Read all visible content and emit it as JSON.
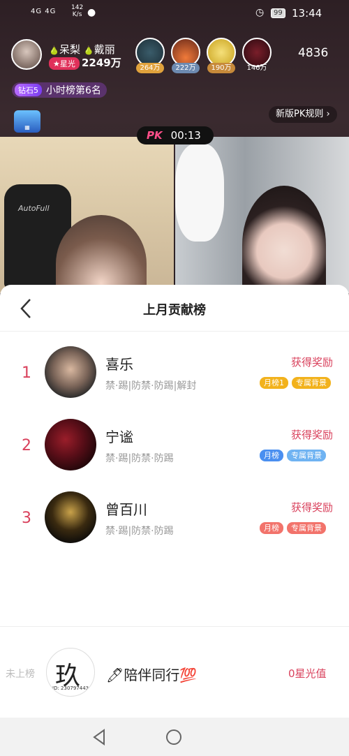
{
  "status_bar": {
    "signal": "4G 4G",
    "net_speed": "142",
    "net_unit": "K/s",
    "battery": "99",
    "time": "13:44"
  },
  "host": {
    "name1": "呆梨",
    "name2": "戴丽",
    "star_label": "★星光",
    "score": "2249万"
  },
  "viewers": [
    {
      "badge": "264万"
    },
    {
      "badge": "222万"
    },
    {
      "badge": "190万"
    },
    {
      "badge": "146万"
    }
  ],
  "viewer_count": "4836",
  "diamond": {
    "tag": "钻石5",
    "rank_text": "小时榜第6名"
  },
  "pk": {
    "rules_label": "新版PK规则 ›",
    "logo": "PK",
    "timer": "00:13"
  },
  "left_pane": {
    "chair_text": "AutoFull"
  },
  "sheet": {
    "title": "上月贡献榜",
    "rows": [
      {
        "rank": "1",
        "name": "喜乐",
        "perms": "禁·踢|防禁·防踢|解封",
        "reward": "获得奖励",
        "badge1": "月榜1",
        "badge2": "专属背景"
      },
      {
        "rank": "2",
        "name": "宁谧",
        "perms": "禁·踢|防禁·防踢",
        "reward": "获得奖励",
        "badge1": "月榜",
        "badge2": "专属背景"
      },
      {
        "rank": "3",
        "name": "曾百川",
        "perms": "禁·踢|防禁·防踢",
        "reward": "获得奖励",
        "badge1": "月榜",
        "badge2": "专属背景"
      }
    ],
    "footer": {
      "not_ranked": "未上榜",
      "avatar_char": "玖",
      "avatar_id": "ID: 230797443",
      "name": "🖊陪伴同行💯",
      "score": "0星光值"
    }
  },
  "colors": {
    "accent": "#d9415c",
    "gold_badge": "#f2b21c",
    "blue_badge": "#4a8ff0",
    "light_blue_badge": "#6fb3f2",
    "red_badge": "#f2736b"
  }
}
